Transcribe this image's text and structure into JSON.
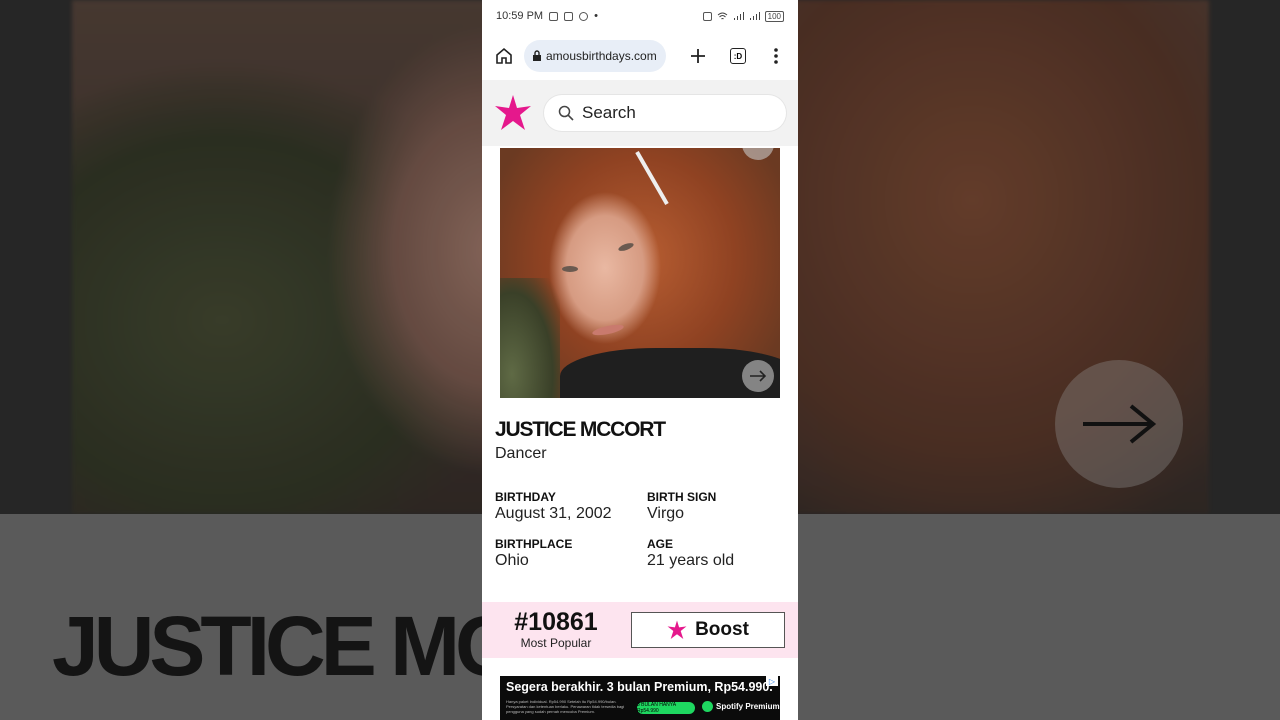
{
  "status_bar": {
    "time": "10:59 PM",
    "battery": "100"
  },
  "browser": {
    "url": "amousbirthdays.com",
    "tab_count": ":D"
  },
  "site": {
    "search_placeholder": "Search",
    "brand_color": "#e5188c"
  },
  "profile": {
    "name": "JUSTICE MCCORT",
    "occupation": "Dancer",
    "facts": {
      "birthday": {
        "label": "BIRTHDAY",
        "value": "August 31, 2002"
      },
      "birth_sign": {
        "label": "BIRTH SIGN",
        "value": "Virgo"
      },
      "birthplace": {
        "label": "BIRTHPLACE",
        "value": "Ohio"
      },
      "age": {
        "label": "AGE",
        "value": "21 years old"
      }
    }
  },
  "rank": {
    "number": "#10861",
    "label": "Most Popular",
    "boost_label": "Boost"
  },
  "ad": {
    "title": "Segera berakhir. 3 bulan Premium, Rp54.990.",
    "fine_print": "Hanya paket Individual. Rp54.990 Setelah itu Rp54.990/bulan. Persyaratan dan ketentuan berlaku. Penawaran tidak tersedia bagi pengguna yang sudah pernah mencoba Premium.",
    "cta": "3 BULAN HANYA Rp54.990",
    "brand": "Spotify Premium"
  },
  "background": {
    "name_text": "JUSTICE MC"
  }
}
